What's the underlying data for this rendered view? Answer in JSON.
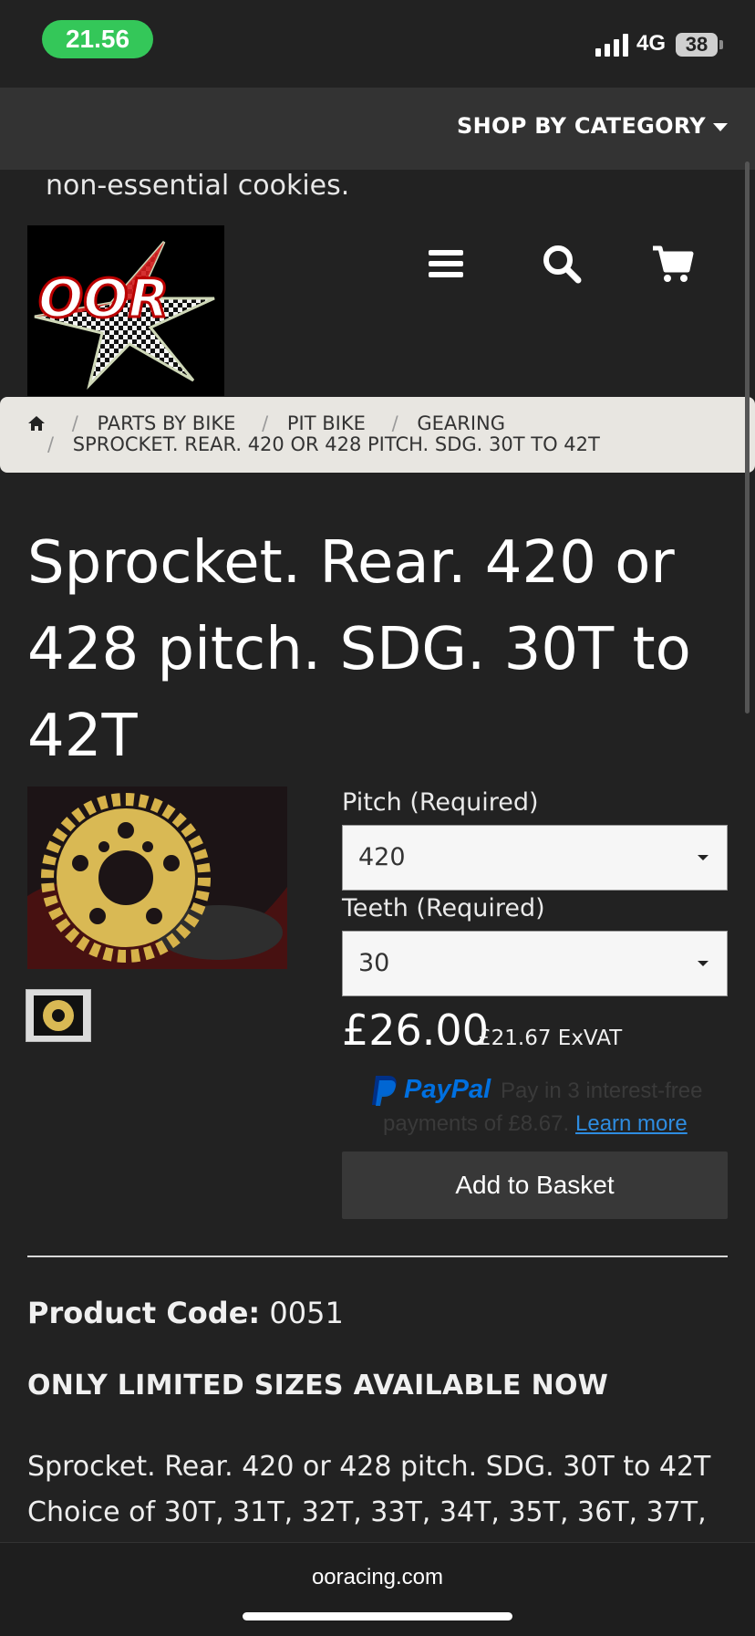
{
  "status_bar": {
    "time": "21.56",
    "network": "4G",
    "battery": "38"
  },
  "nav": {
    "category_label": "SHOP BY CATEGORY"
  },
  "cookie_text": "non-essential cookies.",
  "logo": {
    "text": "OOR",
    "colors": {
      "letters": "#ffffff",
      "accent": "#d11c1c"
    }
  },
  "header_icons": [
    "menu-icon",
    "search-icon",
    "cart-icon"
  ],
  "breadcrumb": {
    "items": [
      "PARTS BY BIKE",
      "PIT BIKE",
      "GEARING"
    ],
    "current": "SPROCKET. REAR. 420 OR 428 PITCH. SDG. 30T TO 42T",
    "separator": "/"
  },
  "product": {
    "title": "Sprocket. Rear. 420 or 428 pitch. SDG. 30T to 42T",
    "options": [
      {
        "label": "Pitch (Required)",
        "value": "420"
      },
      {
        "label": "Teeth (Required)",
        "value": "30"
      }
    ],
    "price": "£26.00",
    "price_ex_vat": "£21.67 ExVAT",
    "paypal": {
      "brand": "PayPal",
      "message_line1": "Pay in 3 interest-free",
      "message_line2": "payments of £8.67.",
      "link": "Learn more"
    },
    "add_to_basket": "Add to Basket",
    "code_label": "Product Code:",
    "code_value": " 0051",
    "notice": "ONLY LIMITED SIZES AVAILABLE NOW",
    "description_line1": "Sprocket. Rear. 420 or 428 pitch. SDG. 30T to 42T",
    "description_line2": "Choice of 30T, 31T, 32T, 33T, 34T, 35T, 36T, 37T,"
  },
  "browser": {
    "url": "ooracing.com"
  },
  "colors": {
    "background": "#222222",
    "bar": "#333333",
    "time_pill": "#34c759",
    "paypal_blue": "#003087",
    "link": "#2e8ce0"
  }
}
